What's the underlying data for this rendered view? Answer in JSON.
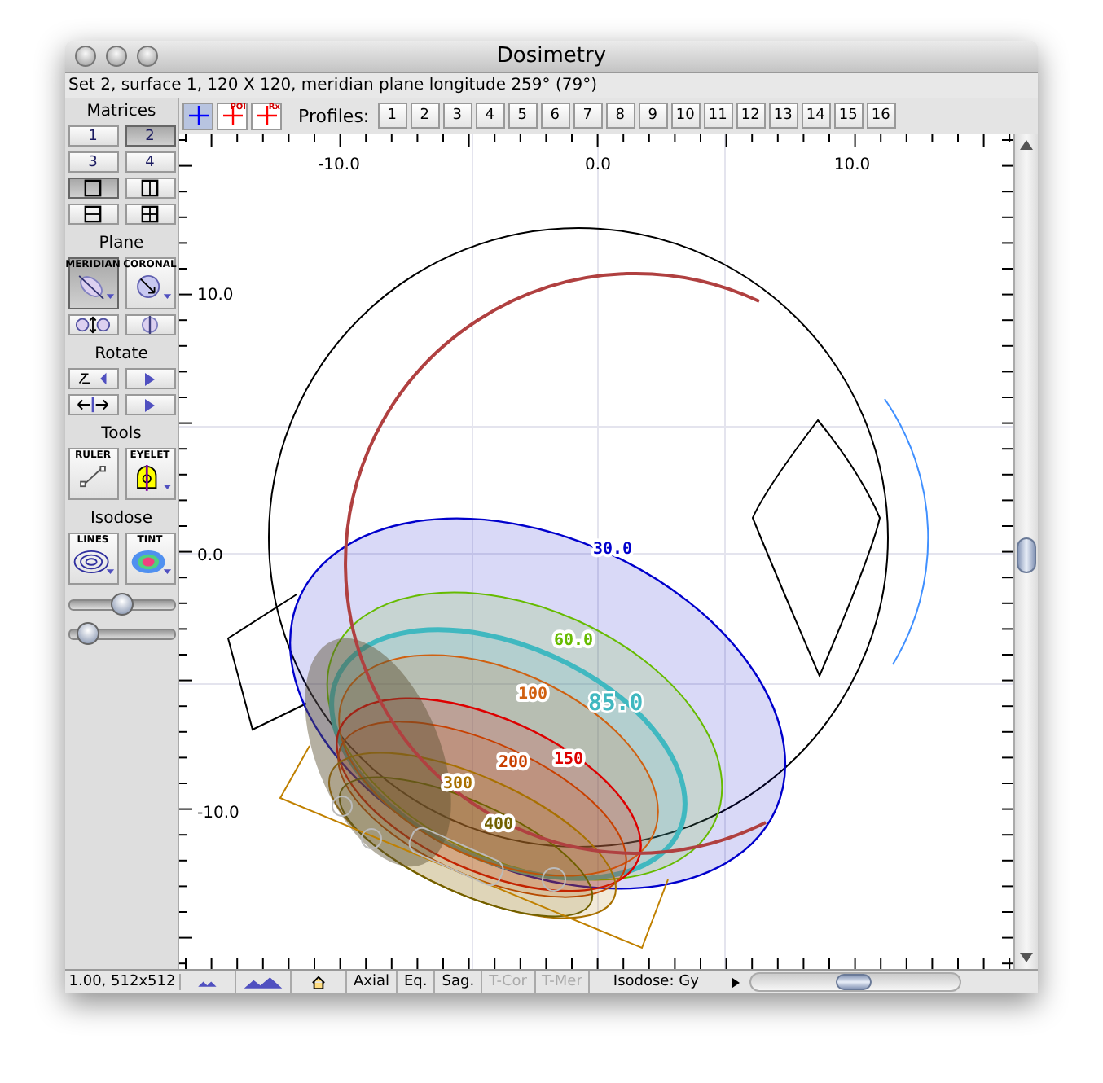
{
  "window": {
    "title": "Dosimetry"
  },
  "info_line": "Set 2, surface 1, 120 X 120, meridian plane longitude 259° (79°)",
  "toolbar": {
    "tools": [
      {
        "kind": "cross",
        "selected": true
      },
      {
        "kind": "cross",
        "label": "POI",
        "selected": false
      },
      {
        "kind": "cross",
        "label": "Rx",
        "selected": false
      }
    ],
    "profiles_label": "Profiles:",
    "profiles": [
      "1",
      "2",
      "3",
      "4",
      "5",
      "6",
      "7",
      "8",
      "9",
      "10",
      "11",
      "12",
      "13",
      "14",
      "15",
      "16"
    ]
  },
  "sidebar": {
    "sections": [
      {
        "heading": "Matrices",
        "rows": [
          [
            {
              "kind": "number",
              "label": "1",
              "selected": false
            },
            {
              "kind": "number",
              "label": "2",
              "selected": true
            }
          ],
          [
            {
              "kind": "number",
              "label": "3",
              "selected": false
            },
            {
              "kind": "number",
              "label": "4",
              "selected": false
            }
          ],
          [
            {
              "kind": "layout-single",
              "selected": true
            },
            {
              "kind": "layout-columns",
              "selected": false
            }
          ],
          [
            {
              "kind": "layout-rows",
              "selected": false
            },
            {
              "kind": "layout-quad",
              "selected": false
            }
          ]
        ]
      },
      {
        "heading": "Plane",
        "rows": [
          [
            {
              "kind": "meridian",
              "label": "MERIDIAN",
              "selected": true
            },
            {
              "kind": "coronal",
              "label": "CORONAL",
              "selected": false
            }
          ],
          [
            {
              "kind": "eyes"
            },
            {
              "kind": "eye-split"
            }
          ]
        ]
      },
      {
        "heading": "Rotate",
        "rows": [
          [
            {
              "kind": "rotate"
            },
            {
              "kind": "play"
            }
          ],
          [
            {
              "kind": "flip"
            },
            {
              "kind": "play"
            }
          ]
        ]
      },
      {
        "heading": "Tools",
        "rows": [
          [
            {
              "kind": "ruler",
              "label": "RULER"
            },
            {
              "kind": "eyelet",
              "label": "EYELET"
            }
          ]
        ]
      },
      {
        "heading": "Isodose",
        "rows": [
          [
            {
              "kind": "lines",
              "label": "LINES"
            },
            {
              "kind": "tint",
              "label": "TINT"
            }
          ]
        ]
      }
    ],
    "sliders": [
      {
        "level": 0.5
      },
      {
        "level": 0.08
      }
    ]
  },
  "plot": {
    "x_labels": [
      "-10.0",
      "0.0",
      "10.0"
    ],
    "y_labels": [
      "10.0",
      "0.0",
      "-10.0"
    ],
    "isodoses": [
      {
        "label": "30.0",
        "color": "#0000cc"
      },
      {
        "label": "60.0",
        "color": "#66bb00"
      },
      {
        "label": "85.0",
        "color": "#40b8c0"
      },
      {
        "label": "100",
        "color": "#d06010"
      },
      {
        "label": "150",
        "color": "#dd0000"
      },
      {
        "label": "200",
        "color": "#c84000"
      },
      {
        "label": "300",
        "color": "#a87000"
      },
      {
        "label": "400",
        "color": "#706000"
      }
    ]
  },
  "status_bar": {
    "readout": "1.00, 512x512",
    "buttons": [
      {
        "kind": "peaks-small"
      },
      {
        "kind": "peaks-large"
      },
      {
        "kind": "home"
      },
      {
        "kind": "text",
        "label": "Axial",
        "disabled": false
      },
      {
        "kind": "text",
        "label": "Eq.",
        "disabled": false
      },
      {
        "kind": "text",
        "label": "Sag.",
        "disabled": false
      },
      {
        "kind": "text",
        "label": "T-Cor",
        "disabled": true
      },
      {
        "kind": "text",
        "label": "T-Mer",
        "disabled": true
      }
    ],
    "isodose_menu": "Isodose: Gy"
  }
}
